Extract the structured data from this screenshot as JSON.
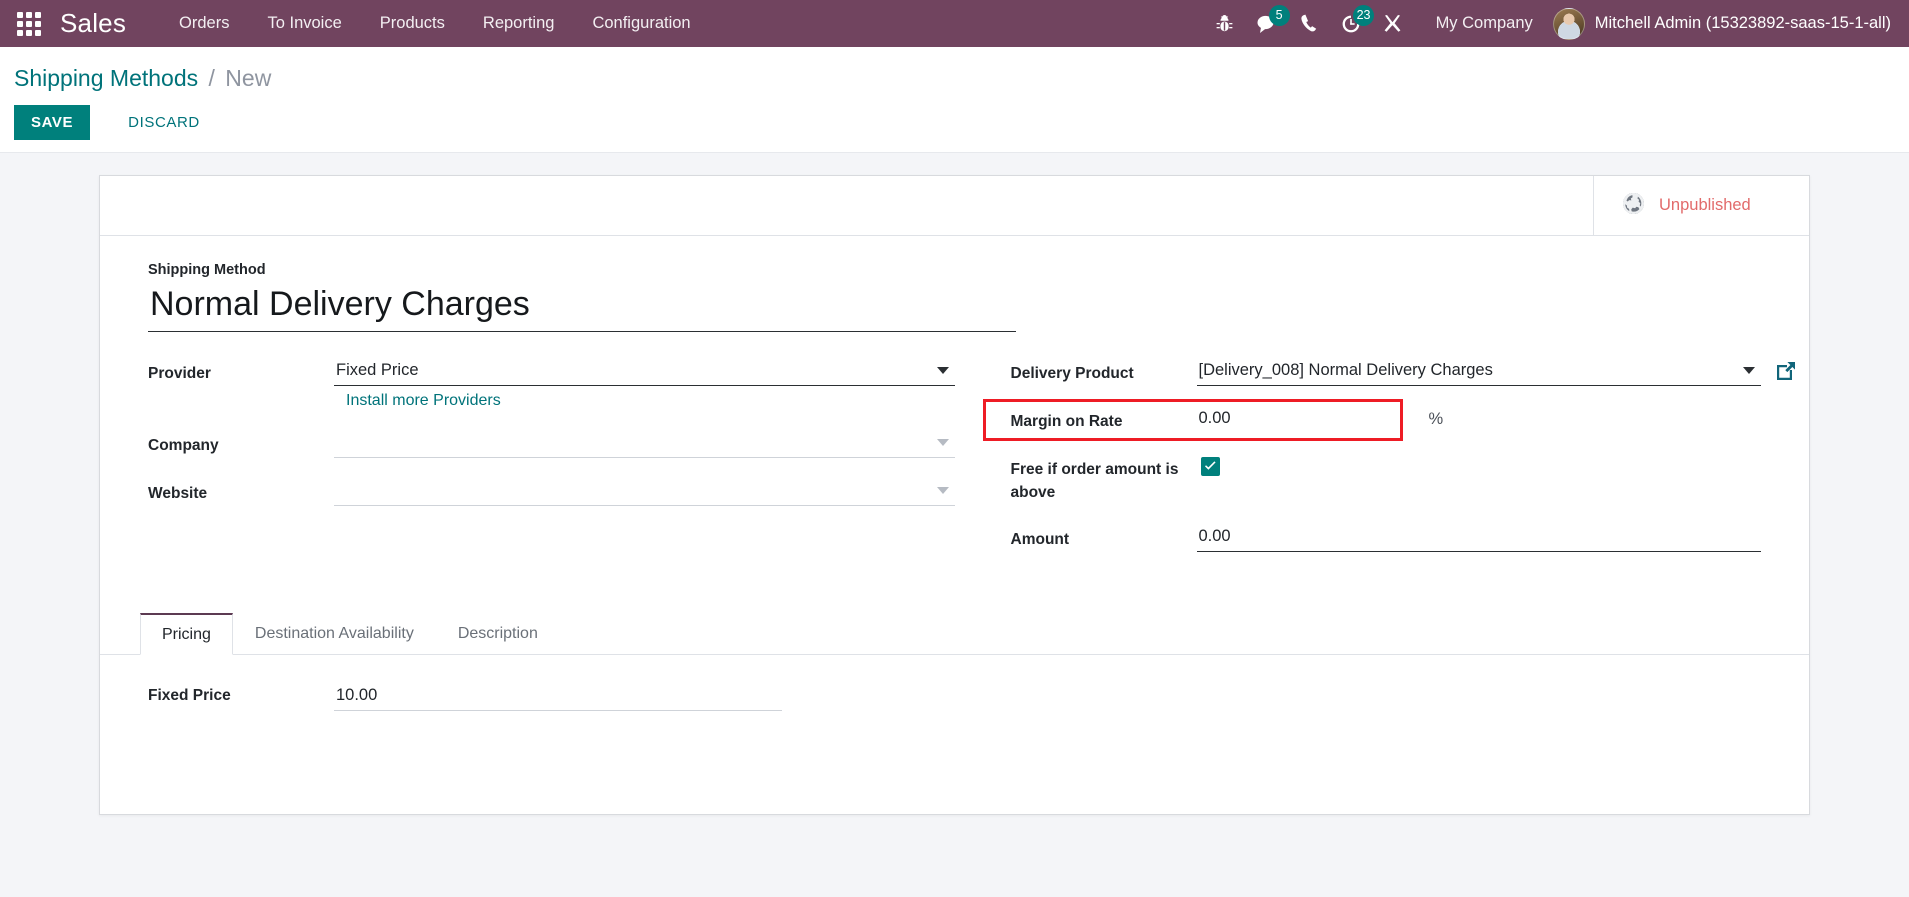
{
  "navbar": {
    "apps_icon": "apps-grid-icon",
    "brand": "Sales",
    "menus": [
      "Orders",
      "To Invoice",
      "Products",
      "Reporting",
      "Configuration"
    ],
    "sys_icons": [
      {
        "name": "bug-icon",
        "badge": ""
      },
      {
        "name": "messages-icon",
        "badge": "5"
      },
      {
        "name": "phone-icon",
        "badge": ""
      },
      {
        "name": "activities-clock-icon",
        "badge": "23"
      },
      {
        "name": "tools-icon",
        "badge": ""
      }
    ],
    "company": "My Company",
    "user": "Mitchell Admin (15323892-saas-15-1-all)",
    "avatar": "user-avatar",
    "bg_color": "#71445f",
    "accent_color": "#00807c"
  },
  "control_panel": {
    "breadcrumb_root": "Shipping Methods",
    "breadcrumb_separator": "/",
    "breadcrumb_current": "New",
    "save_label": "SAVE",
    "discard_label": "DISCARD"
  },
  "statusbar": {
    "publish_icon": "globe-icon",
    "publish_label": "Unpublished",
    "publish_color": "#e26b6b"
  },
  "form": {
    "title_label": "Shipping Method",
    "title_value": "Normal Delivery Charges",
    "title_placeholder": "e.g. Free Shipping",
    "left": {
      "provider": {
        "label": "Provider",
        "value": "Fixed Price",
        "caret": "chevron-down-icon",
        "link": "Install more Providers"
      },
      "company": {
        "label": "Company",
        "value": "",
        "placeholder": "",
        "caret": "chevron-down-icon"
      },
      "website": {
        "label": "Website",
        "value": "",
        "placeholder": "",
        "caret": "chevron-down-icon"
      }
    },
    "right": {
      "delivery_product": {
        "label": "Delivery Product",
        "value": "[Delivery_008] Normal Delivery Charges",
        "caret": "chevron-down-icon",
        "external": "external-link-icon"
      },
      "margin_on_rate": {
        "label": "Margin on Rate",
        "value": "0.00",
        "suffix": "%",
        "highlight_color": "#ee1c25"
      },
      "free_if_above": {
        "label": "Free if order amount is above",
        "checked": true,
        "check_icon": "check-icon"
      },
      "amount": {
        "label": "Amount",
        "value": "0.00"
      }
    }
  },
  "notebook": {
    "tabs": [
      {
        "label": "Pricing",
        "active": true
      },
      {
        "label": "Destination Availability",
        "active": false
      },
      {
        "label": "Description",
        "active": false
      }
    ],
    "pricing": {
      "fixed_price_label": "Fixed Price",
      "fixed_price_value": "10.00"
    }
  }
}
